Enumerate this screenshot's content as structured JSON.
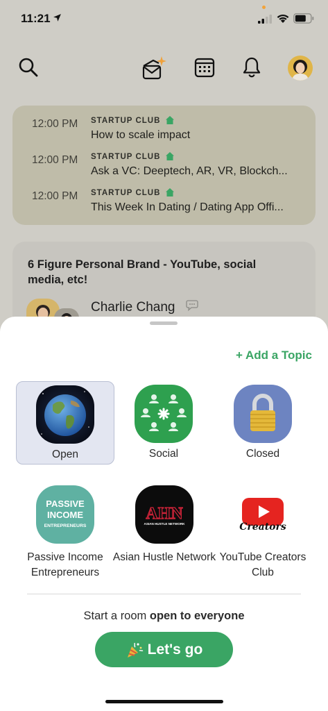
{
  "status_bar": {
    "time": "11:21"
  },
  "events": [
    {
      "time": "12:00 PM",
      "club": "STARTUP CLUB",
      "title": "How to scale impact"
    },
    {
      "time": "12:00 PM",
      "club": "STARTUP CLUB",
      "title": "Ask a VC: Deeptech, AR, VR, Blockch..."
    },
    {
      "time": "12:00 PM",
      "club": "STARTUP CLUB",
      "title": "This Week In Dating / Dating App Offi..."
    }
  ],
  "room_card": {
    "title": "6 Figure Personal Brand - YouTube, social media, etc!",
    "speaker": "Charlie Chang"
  },
  "sheet": {
    "add_topic": "+ Add a Topic",
    "room_types": [
      {
        "label": "Open",
        "icon": "globe-icon",
        "selected": true
      },
      {
        "label": "Social",
        "icon": "people-icon",
        "selected": false
      },
      {
        "label": "Closed",
        "icon": "lock-icon",
        "selected": false
      }
    ],
    "clubs": [
      {
        "label": "Passive Income Entrepreneurs",
        "logo_text": [
          "PASSIVE",
          "INCOME",
          "ENTREPRENEURS"
        ]
      },
      {
        "label": "Asian Hustle Network",
        "logo_text": [
          "AHN",
          "ASIAN HUSTLE NETWORK"
        ]
      },
      {
        "label": "YouTube Creators Club",
        "logo_text": [
          "Creators"
        ]
      }
    ],
    "start_prefix": "Start a room ",
    "start_emphasis": "open to everyone",
    "go_label": "Let's go"
  },
  "colors": {
    "accent": "#3aa564",
    "background": "#cfcdc6",
    "events_card": "#bfbca9",
    "selected_type": "#e3e6f1"
  }
}
